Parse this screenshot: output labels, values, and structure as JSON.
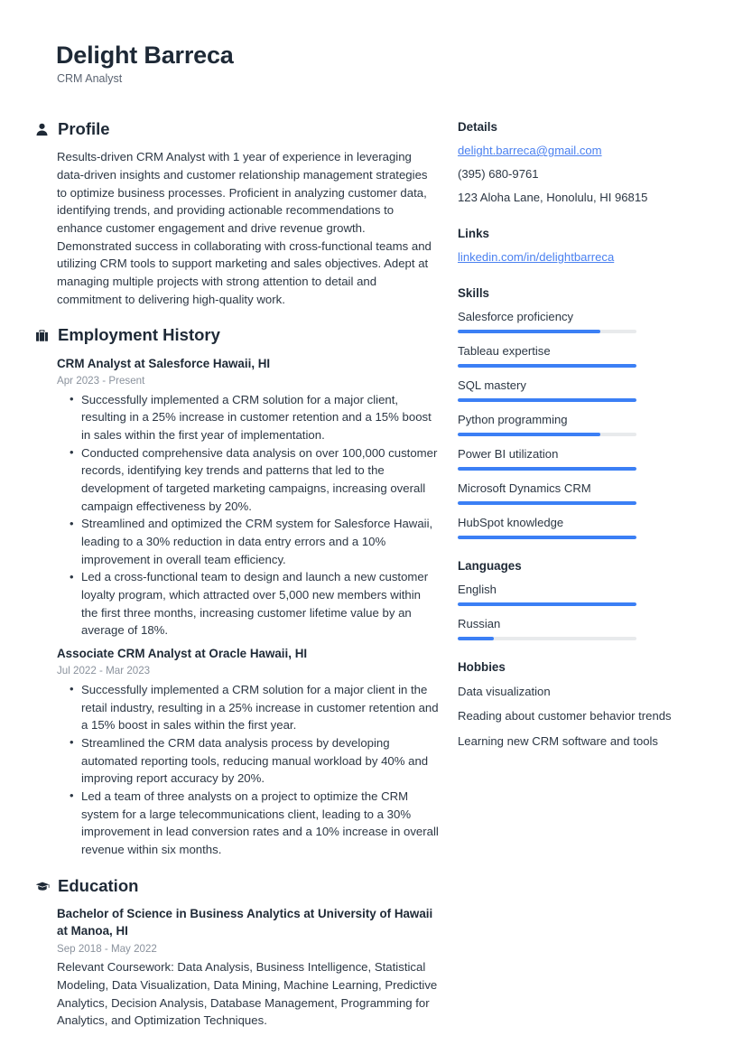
{
  "header": {
    "name": "Delight Barreca",
    "job_title": "CRM Analyst"
  },
  "accent_color": "#3b7ff5",
  "link_color": "#4a80f0",
  "sections": {
    "profile": {
      "icon": "person-icon",
      "title": "Profile",
      "text": "Results-driven CRM Analyst with 1 year of experience in leveraging data-driven insights and customer relationship management strategies to optimize business processes. Proficient in analyzing customer data, identifying trends, and providing actionable recommendations to enhance customer engagement and drive revenue growth. Demonstrated success in collaborating with cross-functional teams and utilizing CRM tools to support marketing and sales objectives. Adept at managing multiple projects with strong attention to detail and commitment to delivering high-quality work."
    },
    "employment": {
      "icon": "briefcase-icon",
      "title": "Employment History",
      "entries": [
        {
          "title": "CRM Analyst at Salesforce Hawaii, HI",
          "date": "Apr 2023 - Present",
          "bullets": [
            "Successfully implemented a CRM solution for a major client, resulting in a 25% increase in customer retention and a 15% boost in sales within the first year of implementation.",
            "Conducted comprehensive data analysis on over 100,000 customer records, identifying key trends and patterns that led to the development of targeted marketing campaigns, increasing overall campaign effectiveness by 20%.",
            "Streamlined and optimized the CRM system for Salesforce Hawaii, leading to a 30% reduction in data entry errors and a 10% improvement in overall team efficiency.",
            "Led a cross-functional team to design and launch a new customer loyalty program, which attracted over 5,000 new members within the first three months, increasing customer lifetime value by an average of 18%."
          ]
        },
        {
          "title": "Associate CRM Analyst at Oracle Hawaii, HI",
          "date": "Jul 2022 - Mar 2023",
          "bullets": [
            "Successfully implemented a CRM solution for a major client in the retail industry, resulting in a 25% increase in customer retention and a 15% boost in sales within the first year.",
            "Streamlined the CRM data analysis process by developing automated reporting tools, reducing manual workload by 40% and improving report accuracy by 20%.",
            "Led a team of three analysts on a project to optimize the CRM system for a large telecommunications client, leading to a 30% improvement in lead conversion rates and a 10% increase in overall revenue within six months."
          ]
        }
      ]
    },
    "education": {
      "icon": "graduation-cap-icon",
      "title": "Education",
      "entries": [
        {
          "title": "Bachelor of Science in Business Analytics at University of Hawaii at Manoa, HI",
          "date": "Sep 2018 - May 2022",
          "description": "Relevant Coursework: Data Analysis, Business Intelligence, Statistical Modeling, Data Visualization, Data Mining, Machine Learning, Predictive Analytics, Decision Analysis, Database Management, Programming for Analytics, and Optimization Techniques."
        }
      ]
    }
  },
  "sidebar": {
    "details": {
      "title": "Details",
      "email": "delight.barreca@gmail.com",
      "phone": "(395) 680-9761",
      "address": "123 Aloha Lane, Honolulu, HI 96815"
    },
    "links": {
      "title": "Links",
      "items": [
        {
          "label": "linkedin.com/in/delightbarreca"
        }
      ]
    },
    "skills": {
      "title": "Skills",
      "items": [
        {
          "label": "Salesforce proficiency",
          "level": 80
        },
        {
          "label": "Tableau expertise",
          "level": 100
        },
        {
          "label": "SQL mastery",
          "level": 100
        },
        {
          "label": "Python programming",
          "level": 80
        },
        {
          "label": "Power BI utilization",
          "level": 100
        },
        {
          "label": "Microsoft Dynamics CRM",
          "level": 100
        },
        {
          "label": "HubSpot knowledge",
          "level": 100
        }
      ]
    },
    "languages": {
      "title": "Languages",
      "items": [
        {
          "label": "English",
          "level": 100
        },
        {
          "label": "Russian",
          "level": 20
        }
      ]
    },
    "hobbies": {
      "title": "Hobbies",
      "items": [
        {
          "label": "Data visualization"
        },
        {
          "label": "Reading about customer behavior trends"
        },
        {
          "label": "Learning new CRM software and tools"
        }
      ]
    }
  }
}
